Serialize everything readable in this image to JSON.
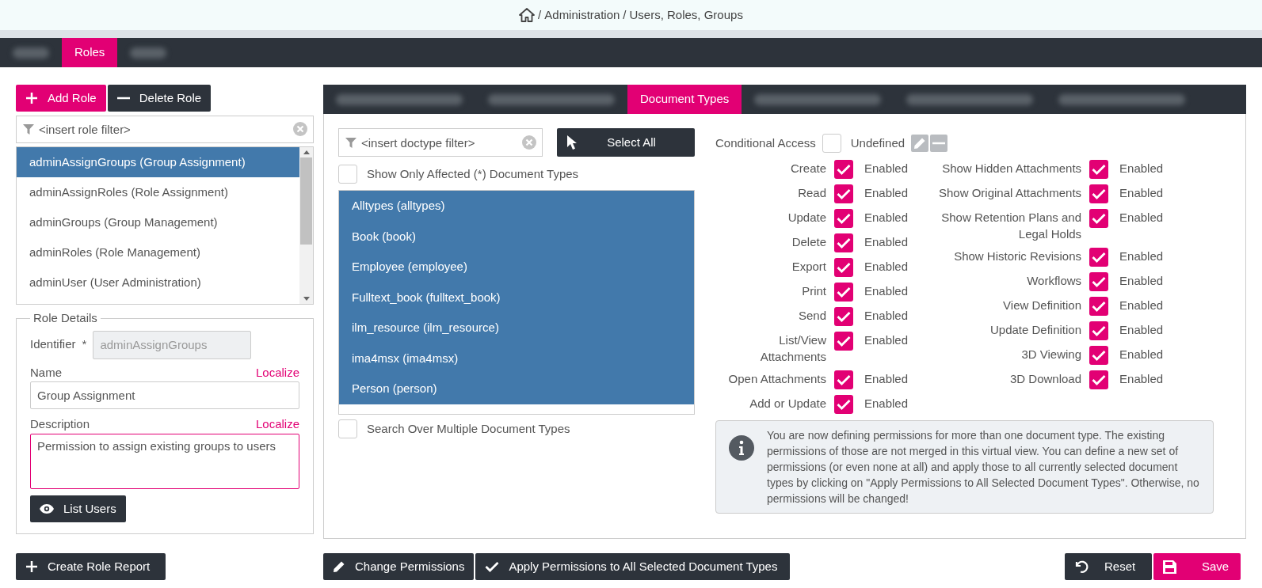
{
  "breadcrumb": {
    "separator": "/",
    "items": [
      "Administration",
      "Users, Roles, Groups"
    ]
  },
  "main_tabs": [
    {
      "kind": "redacted",
      "selected": false
    },
    {
      "kind": "text",
      "label": "Roles",
      "selected": true
    },
    {
      "kind": "redacted",
      "selected": false
    }
  ],
  "role_toolbar": {
    "add_button": "Add Role",
    "delete_button": "Delete Role"
  },
  "role_filter": {
    "placeholder": "<insert role filter>"
  },
  "roles": [
    {
      "label": "adminAssignGroups (Group Assignment)",
      "selected": true
    },
    {
      "label": "adminAssignRoles (Role Assignment)",
      "selected": false
    },
    {
      "label": "adminGroups (Group Management)",
      "selected": false
    },
    {
      "label": "adminRoles (Role Management)",
      "selected": false
    },
    {
      "label": "adminUser (User Administration)",
      "selected": false
    }
  ],
  "role_details": {
    "legend": "Role Details",
    "identifier": {
      "label": "Identifier",
      "required_mark": "*",
      "value": "adminAssignGroups"
    },
    "name": {
      "label": "Name",
      "localize": "Localize",
      "value": "Group Assignment"
    },
    "description": {
      "label": "Description",
      "localize": "Localize",
      "value": "Permission to assign existing groups to users"
    },
    "list_users_button": "List Users"
  },
  "create_report_button": "Create Role Report",
  "doc_tabs": [
    {
      "kind": "redacted",
      "selected": false
    },
    {
      "kind": "redacted",
      "selected": false
    },
    {
      "kind": "text",
      "label": "Document Types",
      "selected": true
    },
    {
      "kind": "redacted",
      "selected": false
    },
    {
      "kind": "redacted",
      "selected": false
    },
    {
      "kind": "redacted",
      "selected": false
    }
  ],
  "doctype_filter": {
    "placeholder": "<insert doctype filter>"
  },
  "select_all_button": "Select All",
  "show_only_affected": {
    "label": "Show Only Affected (*) Document Types",
    "checked": false
  },
  "document_types": [
    {
      "label": "Alltypes (alltypes)",
      "selected": true
    },
    {
      "label": "Book (book)",
      "selected": true
    },
    {
      "label": "Employee (employee)",
      "selected": true
    },
    {
      "label": "Fulltext_book (fulltext_book)",
      "selected": true
    },
    {
      "label": "ilm_resource (ilm_resource)",
      "selected": true
    },
    {
      "label": "ima4msx (ima4msx)",
      "selected": true
    },
    {
      "label": "Person (person)",
      "selected": true
    }
  ],
  "search_multiple": {
    "label": "Search Over Multiple Document Types",
    "checked": false
  },
  "conditional_access": {
    "label": "Conditional Access",
    "checked": false,
    "value": "Undefined"
  },
  "permissions_left": [
    {
      "label": "Create",
      "checked": true,
      "status": "Enabled"
    },
    {
      "label": "Read",
      "checked": true,
      "status": "Enabled"
    },
    {
      "label": "Update",
      "checked": true,
      "status": "Enabled"
    },
    {
      "label": "Delete",
      "checked": true,
      "status": "Enabled"
    },
    {
      "label": "Export",
      "checked": true,
      "status": "Enabled"
    },
    {
      "label": "Print",
      "checked": true,
      "status": "Enabled"
    },
    {
      "label": "Send",
      "checked": true,
      "status": "Enabled"
    },
    {
      "label": "List/View Attachments",
      "checked": true,
      "status": "Enabled"
    },
    {
      "label": "Open Attachments",
      "checked": true,
      "status": "Enabled"
    },
    {
      "label": "Add or Update",
      "checked": true,
      "status": "Enabled"
    }
  ],
  "permissions_right": [
    {
      "label": "Show Hidden Attachments",
      "checked": true,
      "status": "Enabled"
    },
    {
      "label": "Show Original Attachments",
      "checked": true,
      "status": "Enabled"
    },
    {
      "label": "Show Retention Plans and Legal Holds",
      "checked": true,
      "status": "Enabled"
    },
    {
      "label": "Show Historic Revisions",
      "checked": true,
      "status": "Enabled"
    },
    {
      "label": "Workflows",
      "checked": true,
      "status": "Enabled"
    },
    {
      "label": "View Definition",
      "checked": true,
      "status": "Enabled"
    },
    {
      "label": "Update Definition",
      "checked": true,
      "status": "Enabled"
    },
    {
      "label": "3D Viewing",
      "checked": true,
      "status": "Enabled"
    },
    {
      "label": "3D Download",
      "checked": true,
      "status": "Enabled"
    }
  ],
  "info_message": "You are now defining permissions for more than one document type. The existing permissions of those are not merged in this virtual view. You can define a new set of permissions (or even none at all) and apply those to all currently selected document types by clicking on \"Apply Permissions to All Selected Document Types\". Otherwise, no permissions will be changed!",
  "bottom_buttons": {
    "change_permissions": "Change Permissions",
    "apply_permissions": "Apply Permissions to All Selected Document Types",
    "reset": "Reset",
    "save": "Save"
  }
}
